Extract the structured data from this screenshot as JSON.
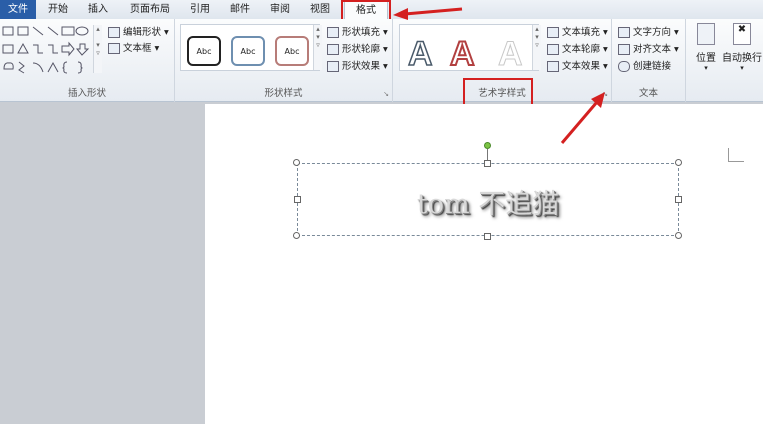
{
  "tabs": [
    {
      "label": "文件"
    },
    {
      "label": "开始"
    },
    {
      "label": "插入"
    },
    {
      "label": "页面布局"
    },
    {
      "label": "引用"
    },
    {
      "label": "邮件"
    },
    {
      "label": "审阅"
    },
    {
      "label": "视图"
    },
    {
      "label": "格式"
    }
  ],
  "groups": {
    "insert_shapes": {
      "label": "插入形状",
      "edit_shape": "编辑形状",
      "text_box": "文本框"
    },
    "shape_styles": {
      "label": "形状样式",
      "samples": [
        "Abc",
        "Abc",
        "Abc"
      ],
      "fill": "形状填充",
      "outline": "形状轮廓",
      "effects": "形状效果"
    },
    "wordart_styles": {
      "label": "艺术字样式",
      "samples": [
        "A",
        "A",
        "A"
      ],
      "text_fill": "文本填充",
      "text_outline": "文本轮廓",
      "text_effects": "文本效果"
    },
    "text": {
      "label": "文本",
      "direction": "文字方向",
      "align": "对齐文本",
      "link": "创建链接"
    },
    "arrange": {
      "position": "位置",
      "wrap": "自动换行"
    }
  },
  "document": {
    "wordart_text": "tom 不追猫"
  },
  "colors": {
    "accent": "#2a5ea8",
    "highlight": "#d42020"
  }
}
